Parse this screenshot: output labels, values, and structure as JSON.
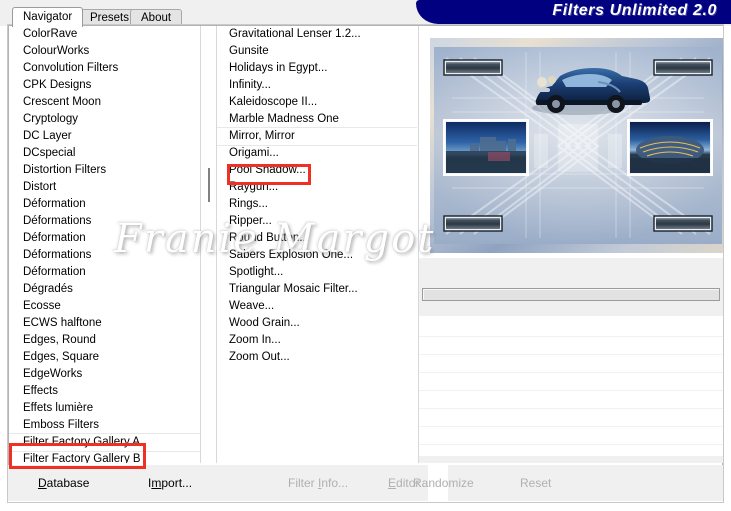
{
  "window": {
    "title": "Filters Unlimited 2.0"
  },
  "tabs": [
    {
      "label": "Navigator",
      "active": true
    },
    {
      "label": "Presets",
      "active": false
    },
    {
      "label": "About",
      "active": false
    }
  ],
  "watermark": {
    "text": "Franie Margot"
  },
  "categories": {
    "name": "filter-category-list",
    "selected": "Filter Factory Gallery A",
    "items": [
      "ColorRave",
      "ColourWorks",
      "Convolution Filters",
      "CPK Designs",
      "Crescent Moon",
      "Cryptology",
      "DC Layer",
      "DCspecial",
      "Distortion Filters",
      "Distort",
      "Déformation",
      "Déformations",
      "Déformation",
      "Déformations",
      "Déformation",
      "Dégradés",
      "Ecosse",
      "ECWS halftone",
      "Edges, Round",
      "Edges, Square",
      "EdgeWorks",
      "Effects",
      "Effets lumière",
      "Emboss Filters",
      "Filter Factory Gallery A",
      "Filter Factory Gallery B"
    ]
  },
  "filters": {
    "name": "filter-list",
    "selected": "Mirror, Mirror",
    "items": [
      "Gravitational Lenser 1.2...",
      "Gunsite",
      "Holidays in Egypt...",
      "Infinity...",
      "Kaleidoscope II...",
      "Marble Madness One",
      "Mirror, Mirror",
      "Origami...",
      "Pool Shadow...",
      "Raygun...",
      "Rings...",
      "Ripper...",
      "Round Button...",
      "Sabers Explosion One...",
      "Spotlight...",
      "Triangular Mosaic Filter...",
      "Weave...",
      "Wood Grain...",
      "Zoom In...",
      "Zoom Out..."
    ]
  },
  "preview": {
    "alt": "mirrored blue and silver collage: vintage blue car, two cityscape photos, metallic corner plates"
  },
  "toolbar": {
    "database": {
      "label": "Database",
      "mnemonic": "D",
      "enabled": true
    },
    "import": {
      "label": "Import...",
      "mnemonic": "m",
      "enabled": true
    },
    "filter_info": {
      "label": "Filter Info...",
      "mnemonic": "I",
      "enabled": false
    },
    "editor": {
      "label": "Editor...",
      "mnemonic": "E",
      "enabled": false
    },
    "randomize": {
      "label": "Randomize",
      "enabled": false
    },
    "reset": {
      "label": "Reset",
      "enabled": false
    }
  },
  "annotations": {
    "boxes": [
      {
        "name": "highlight-mirror-mirror",
        "color": "#ee3124"
      },
      {
        "name": "highlight-filter-factory-gallery-a",
        "color": "#ee3124"
      }
    ]
  },
  "colors": {
    "banner": "#000080",
    "annotation": "#ee3124",
    "panel": "#f0f0f0"
  }
}
